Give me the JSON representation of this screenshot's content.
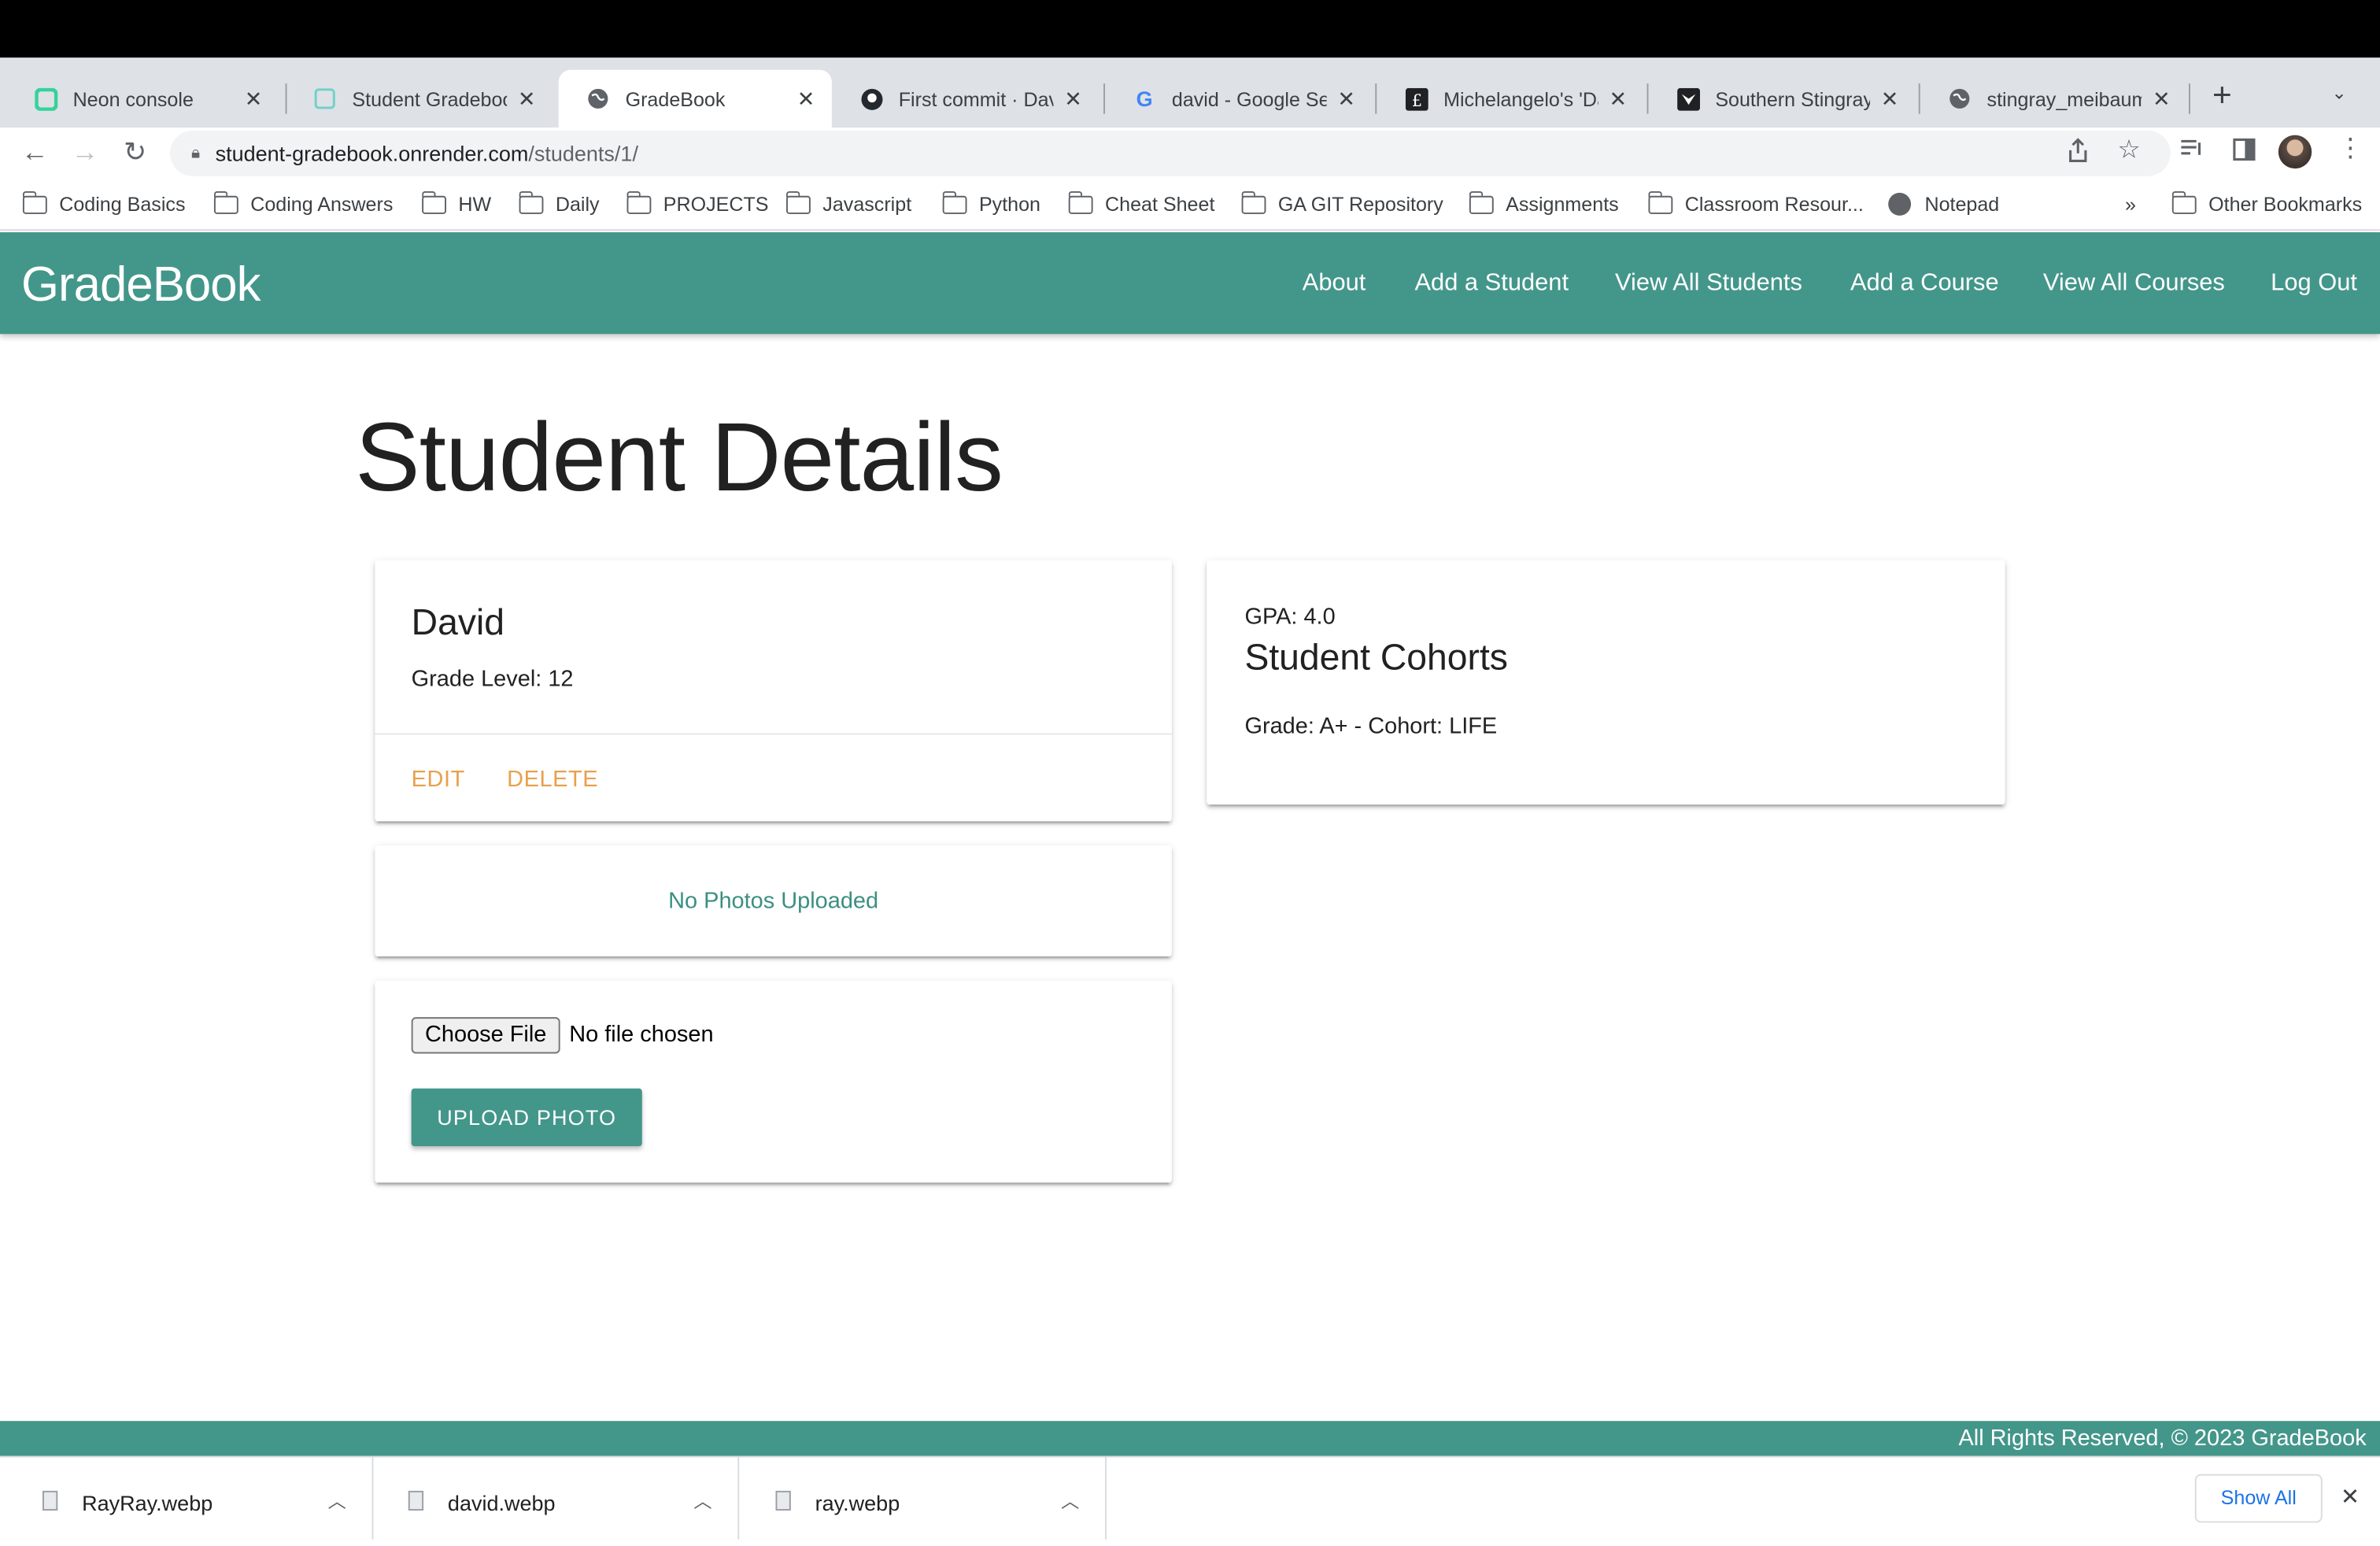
{
  "browser": {
    "tabs": [
      {
        "label": "Neon console",
        "icon": "neon-icon",
        "icon_color": "#34d399"
      },
      {
        "label": "Student Gradebook",
        "icon": "render-icon",
        "icon_color": "#6fd1c7"
      },
      {
        "label": "GradeBook",
        "icon": "globe-icon",
        "active": true
      },
      {
        "label": "First commit · David",
        "icon": "github-icon"
      },
      {
        "label": "david - Google Search",
        "icon": "google-icon"
      },
      {
        "label": "Michelangelo's 'David'",
        "icon": "site-icon"
      },
      {
        "label": "Southern Stingray",
        "icon": "site-icon"
      },
      {
        "label": "stingray_meibaum",
        "icon": "globe-icon"
      }
    ],
    "url_host": "student-gradebook.onrender.com",
    "url_path": "/students/1/",
    "bookmarks": [
      "Coding Basics",
      "Coding Answers",
      "HW",
      "Daily",
      "PROJECTS",
      "Javascript",
      "Python",
      "Cheat Sheet",
      "GA GIT Repository",
      "Assignments",
      "Classroom Resour...",
      "Notepad"
    ],
    "bookmarks_overflow": "»",
    "other_bookmarks": "Other Bookmarks"
  },
  "app": {
    "brand": "GradeBook",
    "nav": [
      "About",
      "Add a Student",
      "View All Students",
      "Add a Course",
      "View All Courses",
      "Log Out"
    ],
    "accent_color": "#43968a"
  },
  "page": {
    "title": "Student Details",
    "student": {
      "name": "David",
      "grade_level": "Grade Level: 12",
      "edit_label": "EDIT",
      "delete_label": "DELETE"
    },
    "summary": {
      "gpa": "GPA: 4.0",
      "cohorts_title": "Student Cohorts",
      "cohort_line": "Grade: A+ - Cohort: LIFE"
    },
    "photos_message": "No Photos Uploaded",
    "upload": {
      "choose_file_label": "Choose File",
      "file_status": "No file chosen",
      "upload_label": "UPLOAD PHOTO"
    },
    "footer": "All Rights Reserved, © 2023 GradeBook"
  },
  "downloads": {
    "items": [
      "RayRay.webp",
      "david.webp",
      "ray.webp"
    ],
    "show_all": "Show All"
  }
}
